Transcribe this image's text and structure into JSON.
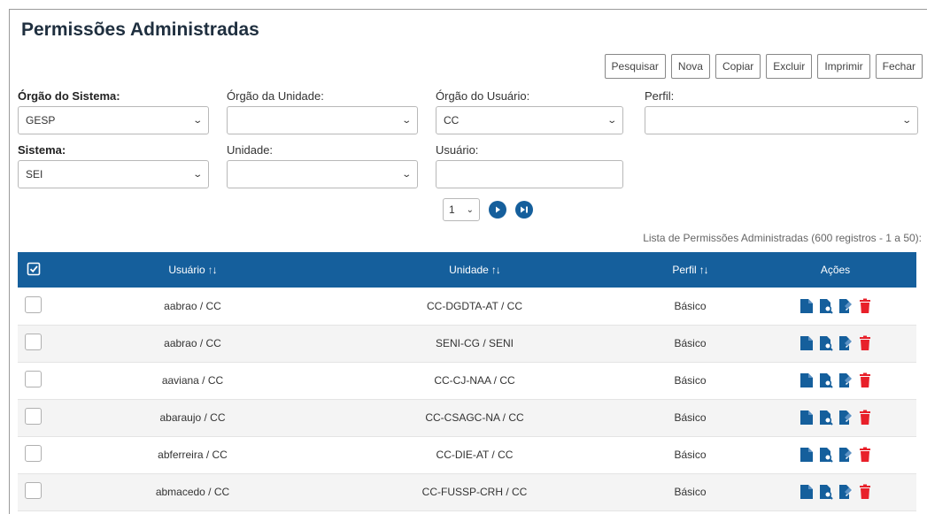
{
  "page": {
    "title": "Permissões Administradas"
  },
  "toolbar": {
    "buttons": [
      "Pesquisar",
      "Nova",
      "Copiar",
      "Excluir",
      "Imprimir",
      "Fechar"
    ]
  },
  "filters": {
    "orgao_sistema": {
      "label": "Órgão do Sistema:",
      "value": "GESP"
    },
    "orgao_unidade": {
      "label": "Órgão da Unidade:",
      "value": ""
    },
    "orgao_usuario": {
      "label": "Órgão do Usuário:",
      "value": "CC"
    },
    "perfil": {
      "label": "Perfil:",
      "value": ""
    },
    "sistema": {
      "label": "Sistema:",
      "value": "SEI"
    },
    "unidade": {
      "label": "Unidade:",
      "value": ""
    },
    "usuario": {
      "label": "Usuário:",
      "value": ""
    }
  },
  "pager": {
    "page": "1"
  },
  "list": {
    "caption": "Lista de Permissões Administradas (600 registros - 1 a 50):",
    "headers": {
      "usuario": "Usuário",
      "unidade": "Unidade",
      "perfil": "Perfil",
      "acoes": "Ações"
    },
    "rows": [
      {
        "usuario": "aabrao / CC",
        "unidade": "CC-DGDTA-AT / CC",
        "perfil": "Básico"
      },
      {
        "usuario": "aabrao / CC",
        "unidade": "SENI-CG / SENI",
        "perfil": "Básico"
      },
      {
        "usuario": "aaviana / CC",
        "unidade": "CC-CJ-NAA / CC",
        "perfil": "Básico"
      },
      {
        "usuario": "abaraujo / CC",
        "unidade": "CC-CSAGC-NA / CC",
        "perfil": "Básico"
      },
      {
        "usuario": "abferreira / CC",
        "unidade": "CC-DIE-AT / CC",
        "perfil": "Básico"
      },
      {
        "usuario": "abmacedo / CC",
        "unidade": "CC-FUSSP-CRH / CC",
        "perfil": "Básico"
      }
    ]
  },
  "colors": {
    "header_bg": "#155f9c",
    "action_blue": "#155f9c",
    "delete_red": "#e8202a"
  }
}
